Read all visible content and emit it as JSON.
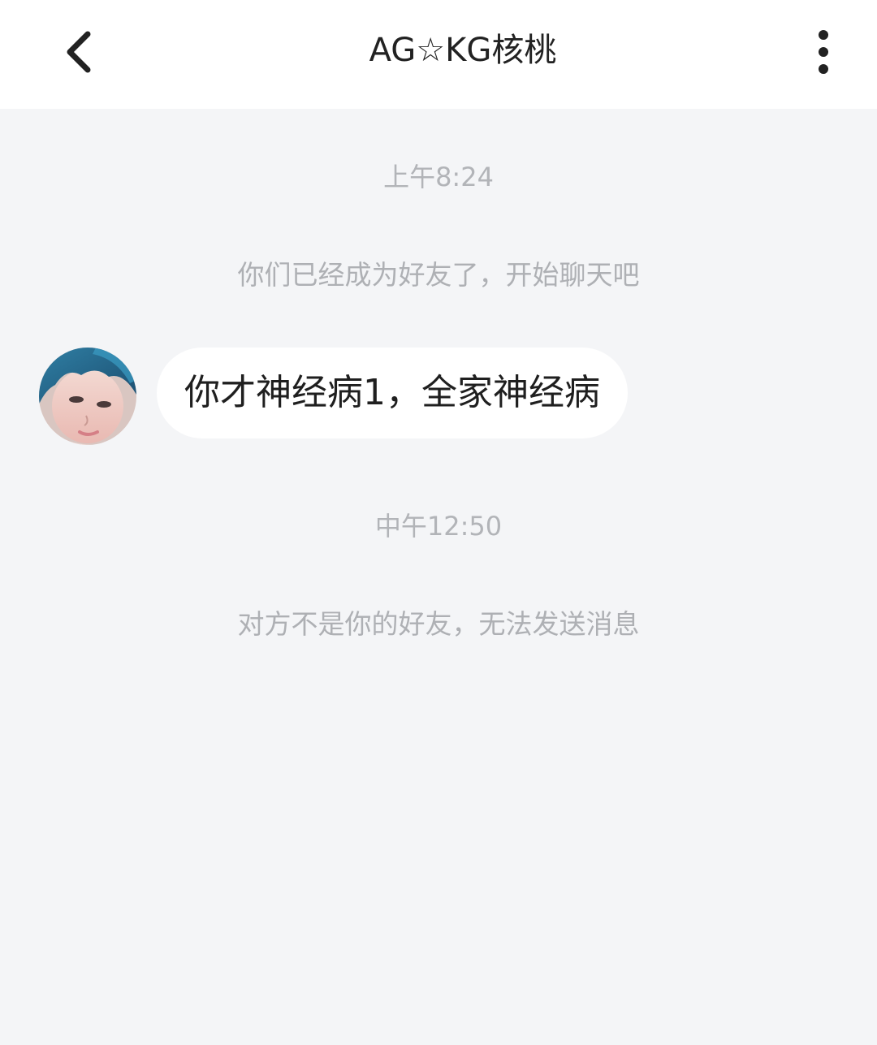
{
  "header": {
    "title": "AG☆KG核桃",
    "back_icon": "chevron-left-icon",
    "more_icon": "more-vertical-icon"
  },
  "chat": {
    "items": [
      {
        "type": "timestamp",
        "text": "上午8:24"
      },
      {
        "type": "system",
        "text": "你们已经成为好友了，开始聊天吧"
      },
      {
        "type": "message",
        "sender": "other",
        "text": "你才神经病1，全家神经病"
      },
      {
        "type": "timestamp",
        "text": "中午12:50"
      },
      {
        "type": "system",
        "text": "对方不是你的好友，无法发送消息"
      }
    ]
  },
  "colors": {
    "header_bg": "#ffffff",
    "chat_bg": "#f4f5f7",
    "bubble_bg": "#ffffff",
    "muted_text": "#b0b2b6",
    "primary_text": "#222222"
  }
}
